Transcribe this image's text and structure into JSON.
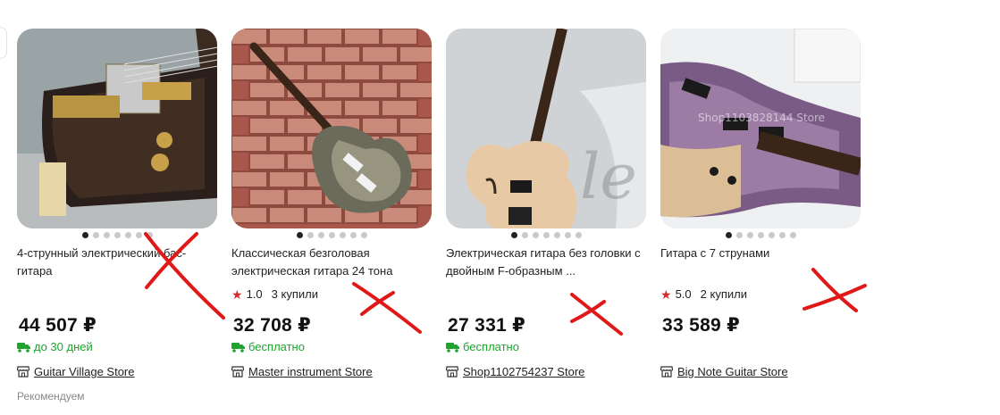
{
  "products": [
    {
      "title": "4-струнный электрический бас-гитара",
      "rating": "",
      "buyers": "",
      "price": "44 507 ₽",
      "delivery": "до 30 дней",
      "store": "Guitar Village Store"
    },
    {
      "title": "Классическая безголовая электрическая гитара 24 тона",
      "rating": "1.0",
      "buyers": "3 купили",
      "price": "32 708 ₽",
      "delivery": "бесплатно",
      "store": "Master instrument Store"
    },
    {
      "title": "Электрическая гитара без головки с двойным F-образным ...",
      "rating": "",
      "buyers": "",
      "price": "27 331 ₽",
      "delivery": "бесплатно",
      "store": "Shop1102754237 Store"
    },
    {
      "title": "Гитара с 7 струнами",
      "rating": "5.0",
      "buyers": "2 купили",
      "price": "33 589 ₽",
      "delivery": "",
      "store": "Big Note Guitar Store"
    }
  ],
  "image_text": {
    "watermark": "Shop1103828144 Store"
  },
  "footer": {
    "recommend": "Рекомендуем"
  },
  "colors": {
    "star": "#d92b2b",
    "delivery_green": "#1fa32f",
    "annotation_red": "#e01818"
  }
}
